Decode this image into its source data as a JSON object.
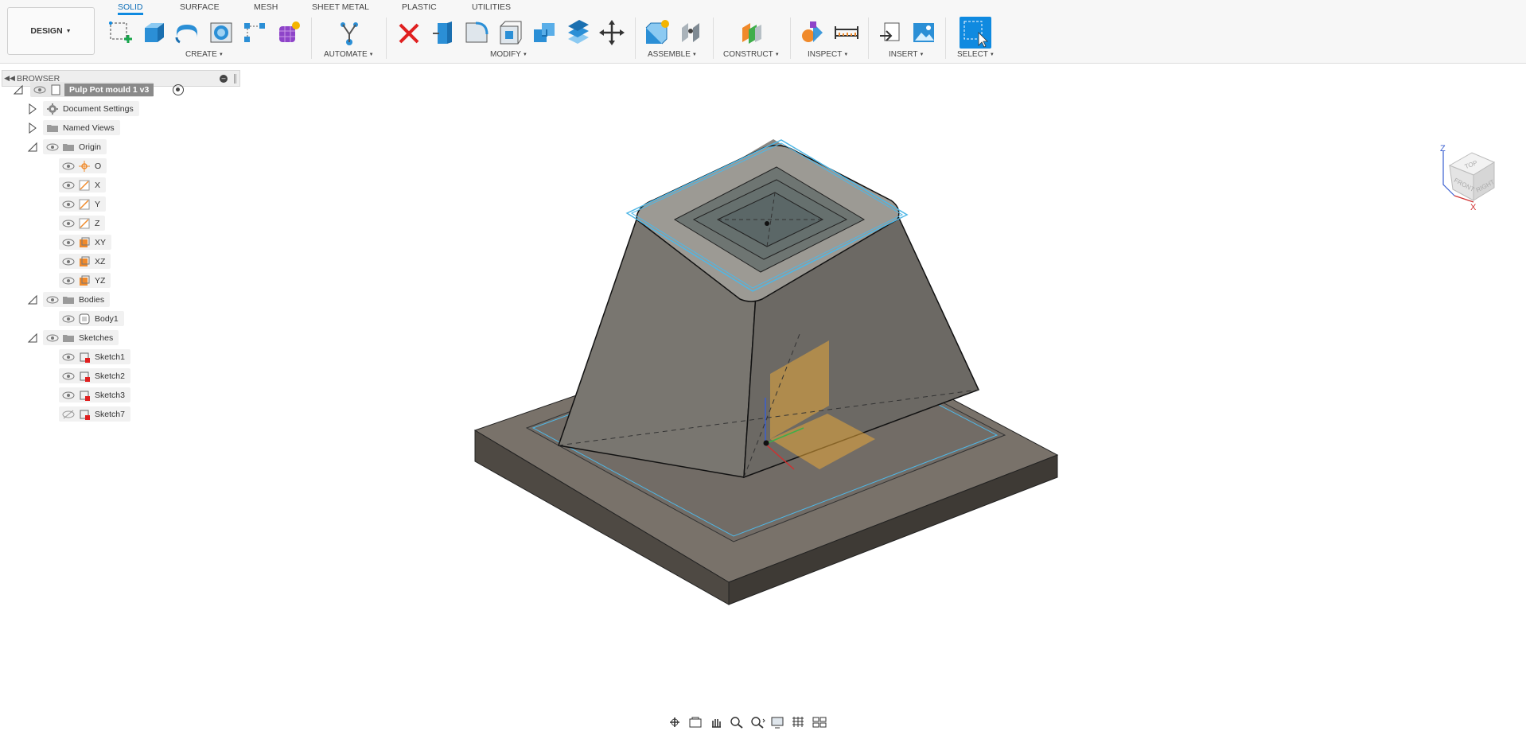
{
  "toolbar": {
    "workspace_button": "DESIGN",
    "tabs": [
      "SOLID",
      "SURFACE",
      "MESH",
      "SHEET METAL",
      "PLASTIC",
      "UTILITIES"
    ],
    "active_tab": "SOLID",
    "groups": {
      "create": "CREATE",
      "automate": "AUTOMATE",
      "modify": "MODIFY",
      "assemble": "ASSEMBLE",
      "construct": "CONSTRUCT",
      "inspect": "INSPECT",
      "insert": "INSERT",
      "select": "SELECT"
    },
    "tools": {
      "create": [
        "create-sketch-icon",
        "extrude-icon",
        "revolve-icon",
        "hole-icon",
        "pattern-icon",
        "create-form-icon"
      ],
      "automate": [
        "automate-icon"
      ],
      "modify": [
        "delete-icon",
        "press-pull-icon",
        "fillet-icon",
        "shell-icon",
        "combine-icon",
        "offset-face-icon",
        "move-copy-icon"
      ],
      "assemble": [
        "new-component-icon",
        "joint-icon"
      ],
      "construct": [
        "offset-plane-icon"
      ],
      "inspect": [
        "measure-shapes-icon",
        "measure-ruler-icon"
      ],
      "insert": [
        "insert-derive-icon",
        "insert-canvas-icon"
      ],
      "select": [
        "select-icon"
      ]
    }
  },
  "browser": {
    "title": "BROWSER",
    "root": "Pulp Pot mould 1 v3",
    "items": [
      {
        "label": "Document Settings",
        "icon": "gear-icon"
      },
      {
        "label": "Named Views",
        "icon": "folder-icon"
      },
      {
        "label": "Origin",
        "icon": "folder-icon"
      },
      {
        "label": "O",
        "icon": "origin-point-icon"
      },
      {
        "label": "X",
        "icon": "axis-icon"
      },
      {
        "label": "Y",
        "icon": "axis-icon"
      },
      {
        "label": "Z",
        "icon": "axis-icon"
      },
      {
        "label": "XY",
        "icon": "plane-icon"
      },
      {
        "label": "XZ",
        "icon": "plane-icon"
      },
      {
        "label": "YZ",
        "icon": "plane-icon"
      },
      {
        "label": "Bodies",
        "icon": "folder-icon"
      },
      {
        "label": "Body1",
        "icon": "body-icon"
      },
      {
        "label": "Sketches",
        "icon": "folder-icon"
      },
      {
        "label": "Sketch1",
        "icon": "sketch-icon"
      },
      {
        "label": "Sketch2",
        "icon": "sketch-icon"
      },
      {
        "label": "Sketch3",
        "icon": "sketch-icon"
      },
      {
        "label": "Sketch7",
        "icon": "sketch-icon"
      }
    ],
    "hidden_items": [
      "Sketch7"
    ]
  },
  "viewcube": {
    "axes": [
      "Z",
      "X"
    ],
    "faces": [
      "TOP",
      "FRONT",
      "RIGHT"
    ]
  },
  "colors": {
    "accent": "#0f8ae0",
    "model_body": "#7a7a74",
    "sketch_line": "#4fb7e6",
    "origin_plane": "#e8a73a"
  },
  "navbar": [
    "orbit-icon",
    "look-at-icon",
    "pan-icon",
    "zoom-window-icon",
    "fit-icon",
    "display-settings-icon",
    "grid-settings-icon",
    "viewports-icon"
  ]
}
